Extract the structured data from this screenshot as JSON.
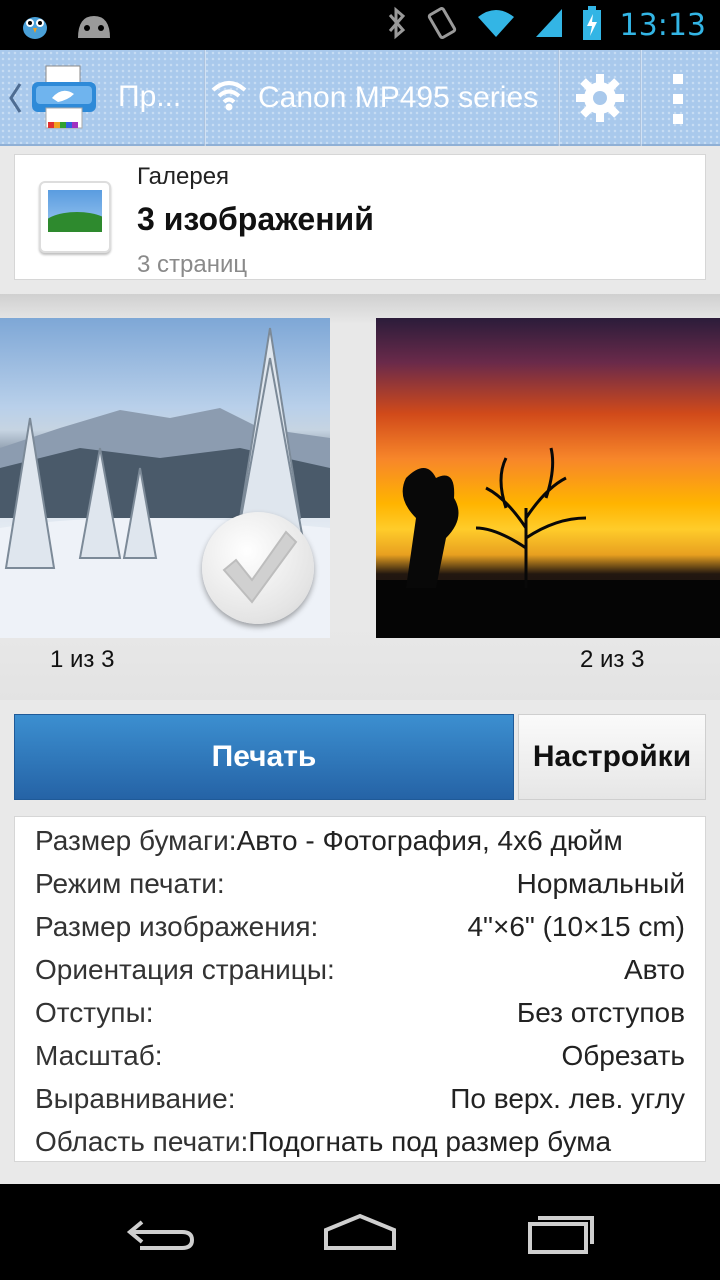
{
  "status_bar": {
    "time": "13:13",
    "icons": [
      "twitter-bird-icon",
      "android-icon",
      "bluetooth-icon",
      "rotation-icon",
      "wifi-icon",
      "signal-icon",
      "battery-charging-icon"
    ]
  },
  "action_bar": {
    "app_title": "Пр...",
    "printer_name": "Canon MP495 series",
    "icons": [
      "back-chevron-icon",
      "app-printer-logo-icon",
      "wifi-icon",
      "gear-icon",
      "overflow-menu-icon"
    ]
  },
  "source": {
    "label": "Галерея",
    "title": "3 изображений",
    "subtitle": "3 страниц",
    "icon": "gallery-icon"
  },
  "previews": [
    {
      "label": "1 из 3",
      "selected": true
    },
    {
      "label": "2 из 3",
      "selected": false
    }
  ],
  "buttons": {
    "print_label": "Печать",
    "settings_label": "Настройки"
  },
  "settings": [
    {
      "key": "Размер бумаги:",
      "value": "Авто - Фотография, 4x6 дюйм"
    },
    {
      "key": "Режим печати:",
      "value": "Нормальный"
    },
    {
      "key": "Размер изображения:",
      "value": "4\"×6\" (10×15 cm)"
    },
    {
      "key": "Ориентация страницы:",
      "value": "Авто"
    },
    {
      "key": "Отступы:",
      "value": "Без отступов"
    },
    {
      "key": "Масштаб:",
      "value": "Обрезать"
    },
    {
      "key": "Выравнивание:",
      "value": "По верх. лев. углу"
    },
    {
      "key": "Область печати:",
      "value": "Подогнать под размер бума"
    }
  ],
  "nav_bar": {
    "icons": [
      "back-icon",
      "home-icon",
      "recent-apps-icon"
    ]
  },
  "colors": {
    "accent": "#33b5e5",
    "print_button": "#2f78bc",
    "action_bar": "#a9c9ec"
  }
}
